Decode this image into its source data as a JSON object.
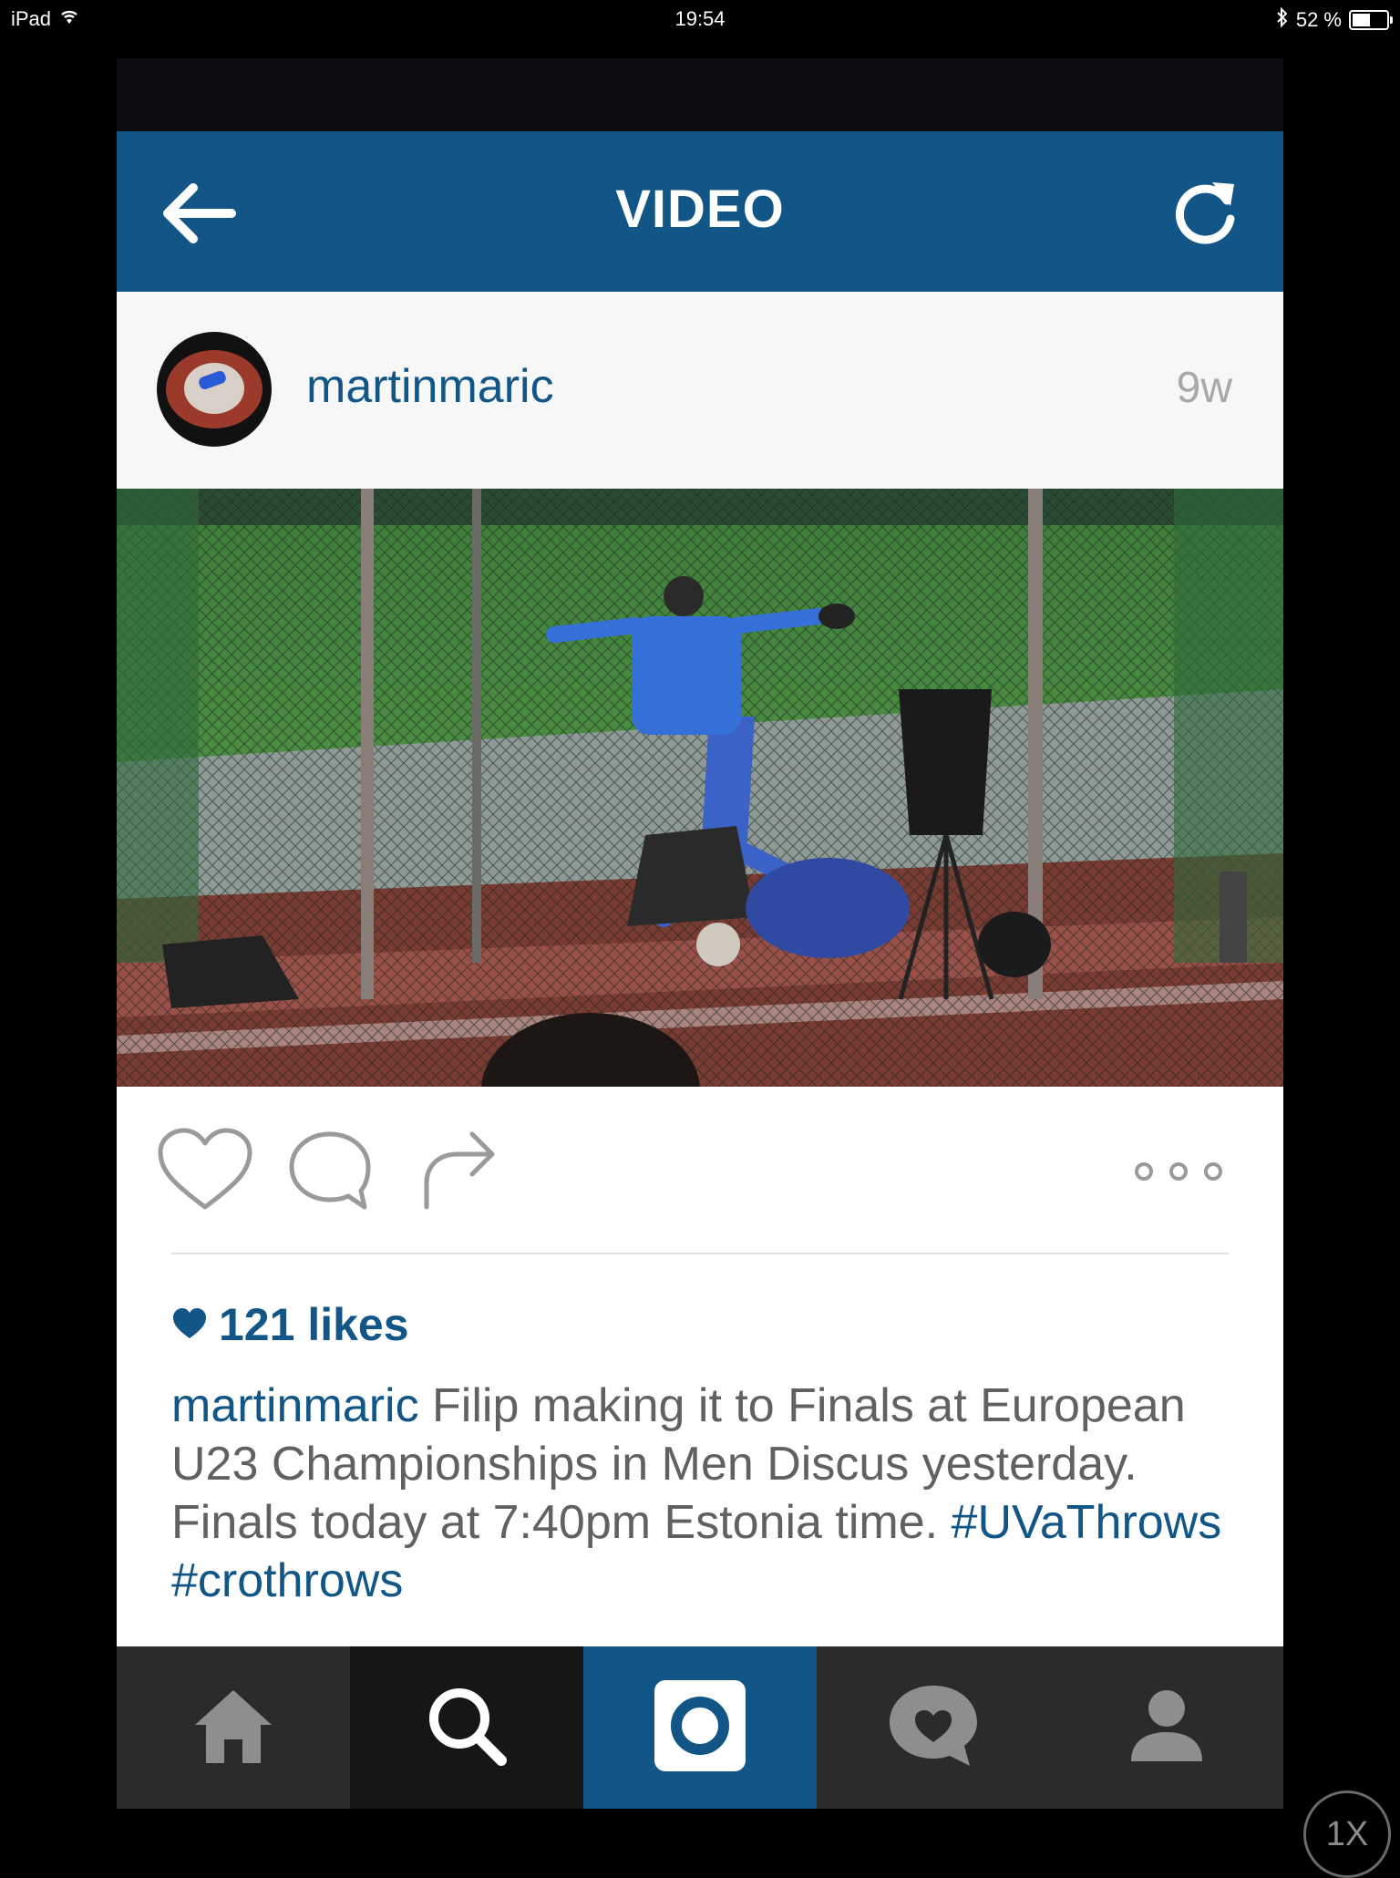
{
  "status_bar": {
    "device": "iPad",
    "time": "19:54",
    "battery": "52 %",
    "battery_level": 0.52
  },
  "nav": {
    "title": "VIDEO",
    "back_icon": "back-arrow-icon",
    "refresh_icon": "refresh-icon"
  },
  "post": {
    "username": "martinmaric",
    "time_ago": "9w",
    "likes": "121 likes",
    "caption_user": "martinmaric",
    "caption_text": " Filip making it to Finals at European U23 Championships in Men Discus yesterday. Finals today at 7:40pm Estonia time. ",
    "hashtags": [
      "#UVaThrows",
      "#crothrows"
    ]
  },
  "actions": {
    "like_icon": "heart-icon",
    "comment_icon": "comment-icon",
    "share_icon": "share-icon",
    "more_icon": "more-icon"
  },
  "tabs": [
    {
      "name": "home",
      "icon": "home-icon"
    },
    {
      "name": "search",
      "icon": "search-icon"
    },
    {
      "name": "camera",
      "icon": "camera-icon",
      "selected": true
    },
    {
      "name": "activity",
      "icon": "activity-icon"
    },
    {
      "name": "profile",
      "icon": "profile-icon"
    }
  ],
  "zoom": "1X",
  "colors": {
    "brand": "#125688",
    "tab_bg": "#2b2b2d",
    "secondary_text": "#616161"
  }
}
